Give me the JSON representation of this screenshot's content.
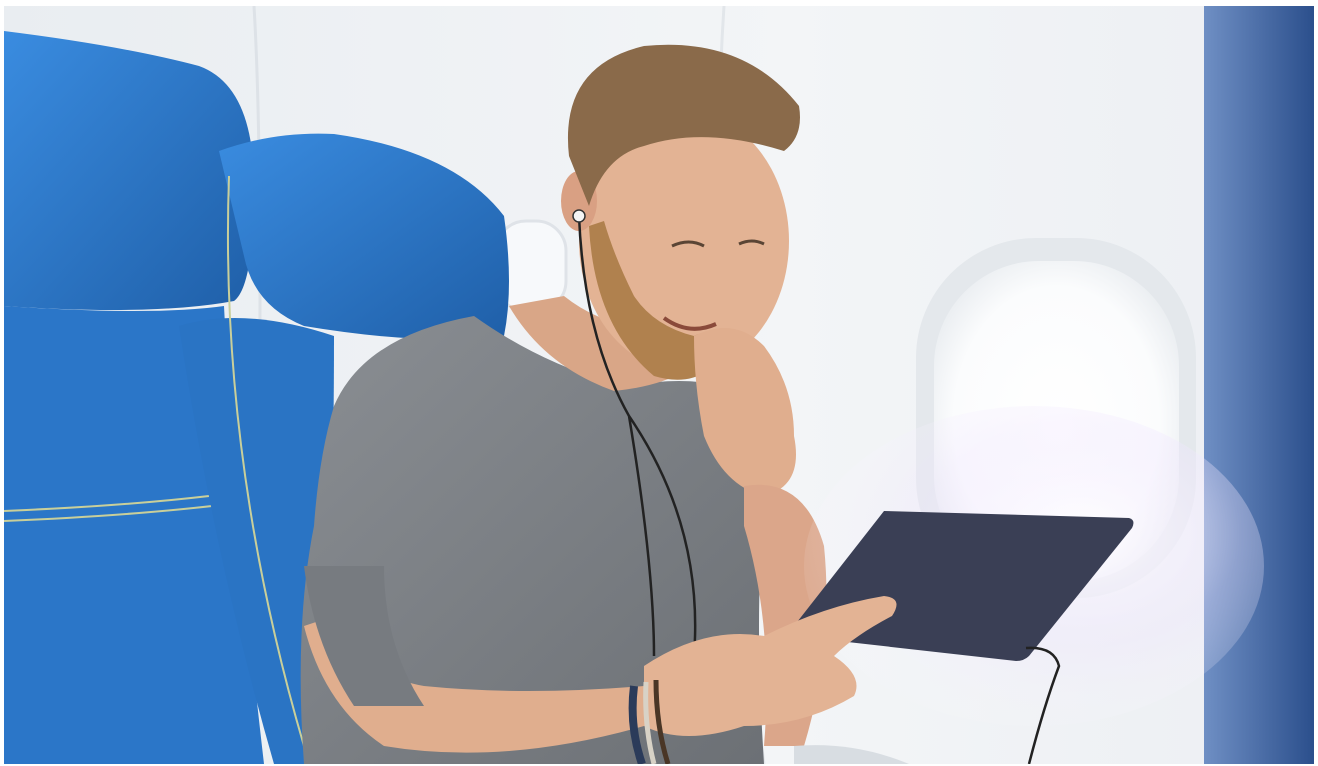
{
  "photo": {
    "subject": "man-with-tablet-in-airplane-seat",
    "palette": {
      "cabin_wall": "#eef1f4",
      "seat_blue": "#2f7fd0",
      "seat_blue_dark": "#1f5fa8",
      "shirt_gray": "#7b7f84",
      "skin": "#e3b394",
      "hair": "#8a6a4a",
      "beard": "#b0814e",
      "tablet": "#3a3f55",
      "window_glow": "#ffffff",
      "side_blue": "#3b5f9a"
    }
  }
}
